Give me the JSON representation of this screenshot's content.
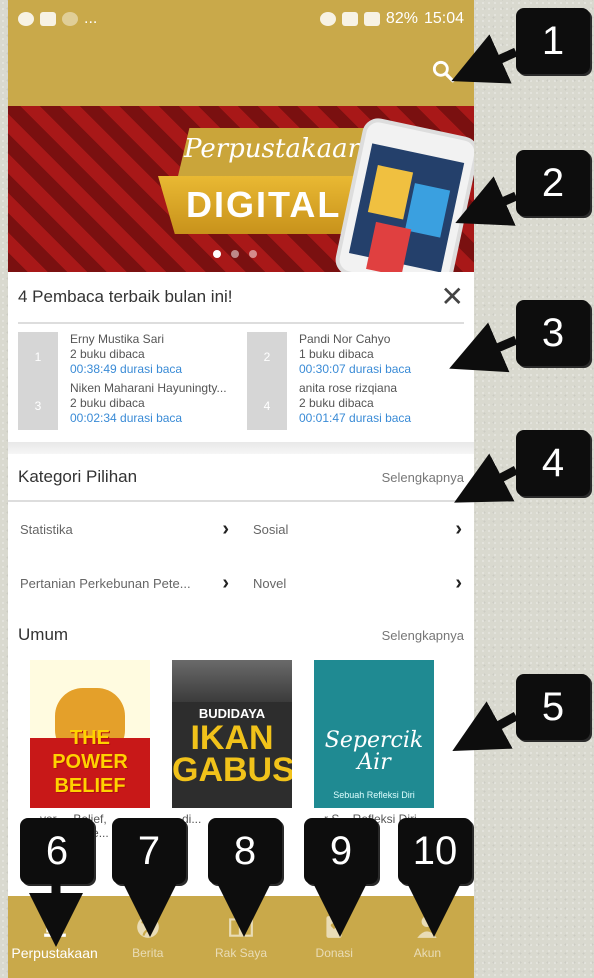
{
  "status_bar": {
    "battery": "82%",
    "time": "15:04"
  },
  "banner": {
    "title": "Perpustakaan",
    "subtitle": "DIGITAL",
    "slide_count": 3,
    "active_slide": 0
  },
  "readers": {
    "title": "4 Pembaca terbaik bulan ini!",
    "entries": [
      {
        "rank": "1",
        "name": "Erny Mustika Sari",
        "books": "2 buku dibaca",
        "duration": "00:38:49 durasi baca"
      },
      {
        "rank": "2",
        "name": "Pandi Nor Cahyo",
        "books": "1 buku dibaca",
        "duration": "00:30:07 durasi baca"
      },
      {
        "rank": "3",
        "name": "Niken Maharani Hayuningty...",
        "books": "2 buku dibaca",
        "duration": "00:02:34 durasi baca"
      },
      {
        "rank": "4",
        "name": "anita rose rizqiana",
        "books": "2 buku dibaca",
        "duration": "00:01:47 durasi baca"
      }
    ]
  },
  "categories": {
    "title": "Kategori Pilihan",
    "more": "Selengkapnya",
    "items": [
      "Statistika",
      "Sosial",
      "Pertanian Perkebunan Pete...",
      "Novel"
    ]
  },
  "umum": {
    "title": "Umum",
    "more": "Selengkapnya",
    "books": [
      {
        "cover_line1": "THE POWER",
        "cover_line2": "BELIEF",
        "title": "...ver ... Belief, Seberapa be..."
      },
      {
        "cover_top": "BUDIDAYA",
        "cover_line1": "IKAN",
        "cover_line2": "GABUS",
        "title": "...di..."
      },
      {
        "cover_line1": "Sepercik",
        "cover_line2": "Air",
        "cover_sub": "Sebuah Refleksi Diri",
        "title": "...r S... Refleksi Diri"
      }
    ]
  },
  "nav": [
    {
      "label": "Perpustakaan",
      "icon": "library-icon"
    },
    {
      "label": "Berita",
      "icon": "globe-icon"
    },
    {
      "label": "Rak Saya",
      "icon": "book-open-icon"
    },
    {
      "label": "Donasi",
      "icon": "donation-book-icon"
    },
    {
      "label": "Akun",
      "icon": "person-icon"
    }
  ],
  "callouts": [
    "1",
    "2",
    "3",
    "4",
    "5",
    "6",
    "7",
    "8",
    "9",
    "10"
  ],
  "colors": {
    "primary": "#c9a94a",
    "link": "#3a8bd6",
    "banner_red": "#a81818"
  }
}
